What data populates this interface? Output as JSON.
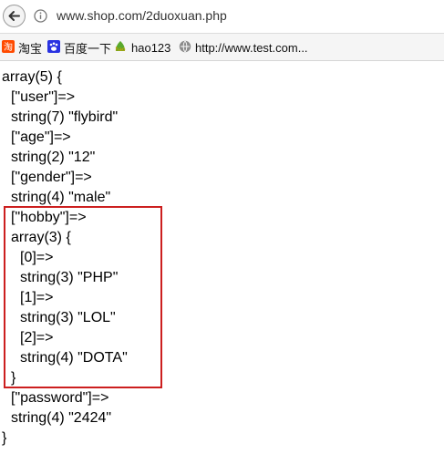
{
  "browser": {
    "url": "www.shop.com/2duoxuan.php",
    "bookmarks": [
      {
        "label": "淘宝",
        "icon": "taobao-icon"
      },
      {
        "label": "百度一下",
        "icon": "baidu-paw-icon"
      },
      {
        "label": "hao123",
        "icon": "hao123-icon"
      },
      {
        "label": "http://www.test.com...",
        "icon": "globe-icon"
      }
    ]
  },
  "dump": {
    "lines": [
      "array(5) {",
      "[\"user\"]=>",
      "string(7) \"flybird\"",
      "[\"age\"]=>",
      "string(2) \"12\"",
      "[\"gender\"]=>",
      "string(4) \"male\"",
      "[\"hobby\"]=>",
      "array(3) {",
      "[0]=>",
      "string(3) \"PHP\"",
      "[1]=>",
      "string(3) \"LOL\"",
      "[2]=>",
      "string(4) \"DOTA\"",
      "}",
      "[\"password\"]=>",
      "string(4) \"2424\"",
      "}"
    ]
  },
  "highlight": {
    "color": "#cc1f1f"
  }
}
